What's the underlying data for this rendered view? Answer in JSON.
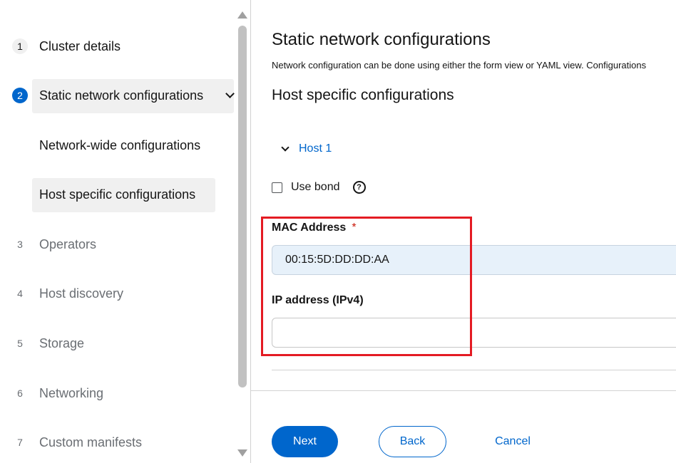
{
  "wizard": {
    "steps": [
      {
        "number": "1",
        "label": "Cluster details"
      },
      {
        "number": "2",
        "label": "Static network configurations"
      },
      {
        "number": "3",
        "label": "Operators"
      },
      {
        "number": "4",
        "label": "Host discovery"
      },
      {
        "number": "5",
        "label": "Storage"
      },
      {
        "number": "6",
        "label": "Networking"
      },
      {
        "number": "7",
        "label": "Custom manifests"
      }
    ],
    "substeps": [
      {
        "label": "Network-wide configurations"
      },
      {
        "label": "Host specific configurations"
      }
    ]
  },
  "main": {
    "title": "Static network configurations",
    "description": "Network configuration can be done using either the form view or YAML view. Configurations",
    "section_title": "Host specific configurations",
    "host_toggle_label": "Host 1",
    "use_bond_label": "Use bond",
    "help_icon_glyph": "?",
    "mac_label": "MAC Address",
    "mac_required_marker": "*",
    "mac_value": "00:15:5D:DD:DD:AA",
    "ip_label": "IP address (IPv4)",
    "ip_value": ""
  },
  "footer": {
    "next_label": "Next",
    "back_label": "Back",
    "cancel_label": "Cancel"
  },
  "colors": {
    "accent": "#0066cc",
    "highlight": "#e41b23",
    "required": "#c9190b"
  }
}
